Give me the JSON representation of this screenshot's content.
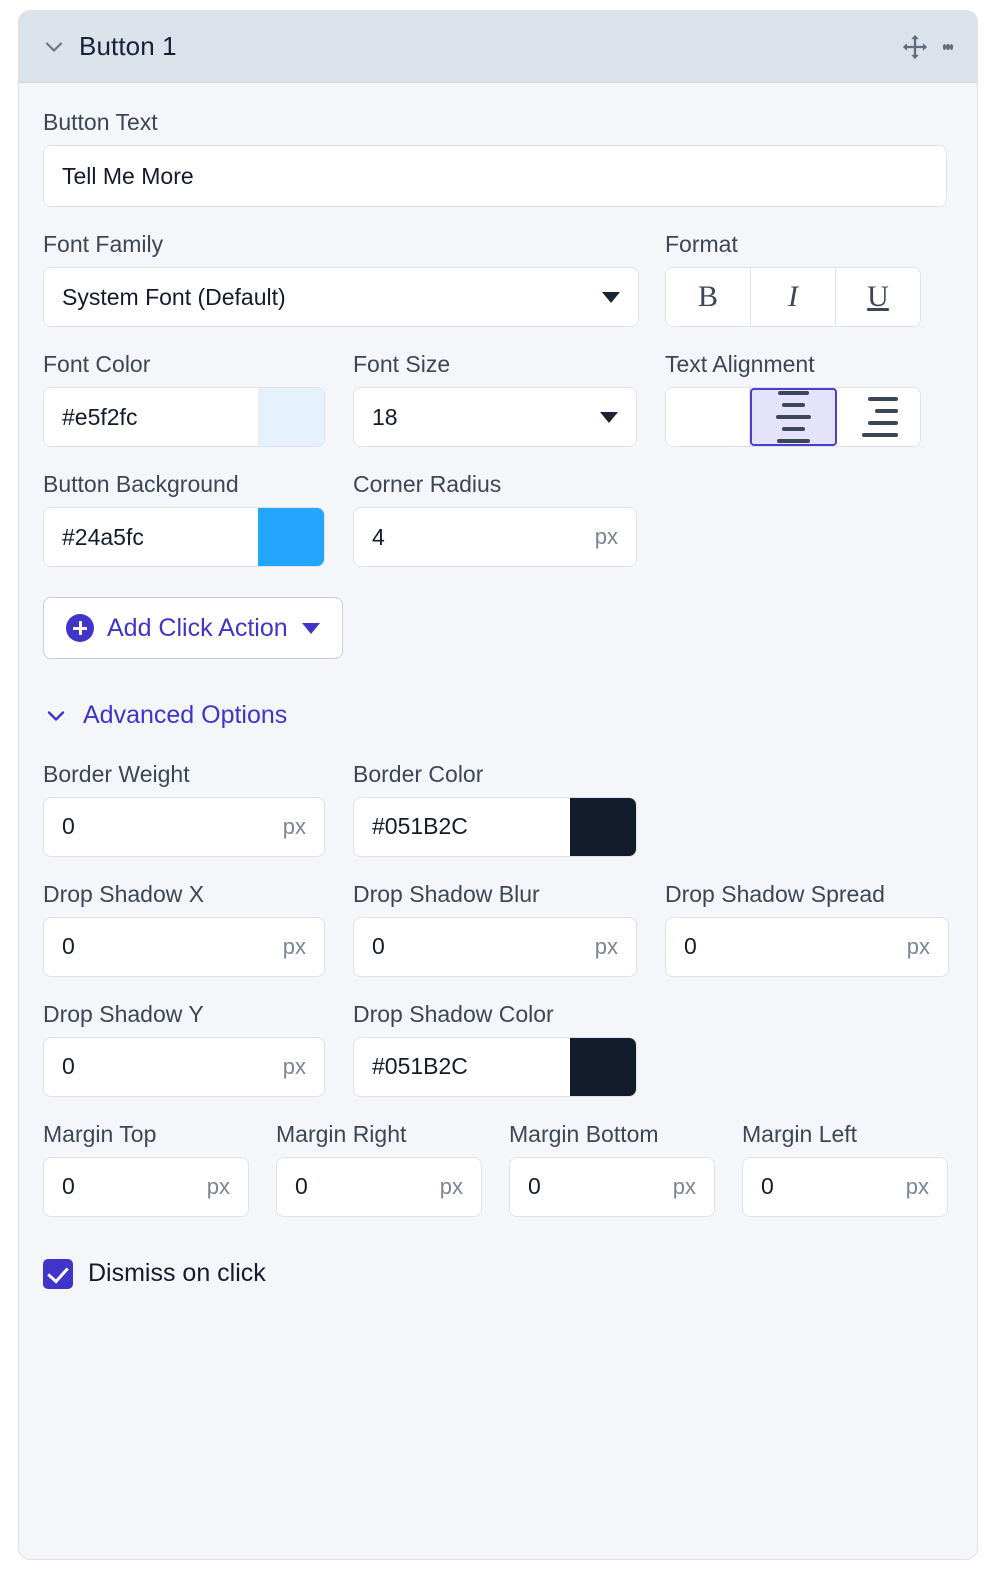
{
  "panel": {
    "header": {
      "title": "Button 1",
      "collapse_icon": "chevron-down-icon",
      "move_icon": "move-cross-arrows-icon",
      "menu_icon": "kebab-menu-icon"
    },
    "button_text": {
      "label": "Button Text",
      "value": "Tell Me More"
    },
    "font_family": {
      "label": "Font Family",
      "value": "System Font (Default)"
    },
    "format": {
      "label": "Format",
      "buttons": [
        {
          "name": "bold",
          "glyph": "B",
          "active": false
        },
        {
          "name": "italic",
          "glyph": "I",
          "active": false
        },
        {
          "name": "underline",
          "glyph": "U",
          "active": false
        }
      ]
    },
    "font_color": {
      "label": "Font Color",
      "value": "#e5f2fc",
      "swatch": "#e5f2fc"
    },
    "font_size": {
      "label": "Font Size",
      "value": "18"
    },
    "text_alignment": {
      "label": "Text Alignment",
      "options": [
        {
          "name": "align-left",
          "selected": false
        },
        {
          "name": "align-center",
          "selected": true
        },
        {
          "name": "align-right",
          "selected": false
        }
      ]
    },
    "button_background": {
      "label": "Button Background",
      "value": "#24a5fc",
      "swatch": "#24a5fc"
    },
    "corner_radius": {
      "label": "Corner Radius",
      "value": "4",
      "unit": "px"
    },
    "add_click_action": {
      "label": "Add Click Action"
    },
    "advanced_options": {
      "label": "Advanced Options"
    },
    "border_weight": {
      "label": "Border Weight",
      "value": "0",
      "unit": "px"
    },
    "border_color": {
      "label": "Border Color",
      "value": "#051B2C",
      "swatch": "#121c2c"
    },
    "drop_shadow_x": {
      "label": "Drop Shadow X",
      "value": "0",
      "unit": "px"
    },
    "drop_shadow_blur": {
      "label": "Drop Shadow Blur",
      "value": "0",
      "unit": "px"
    },
    "drop_shadow_spread": {
      "label": "Drop Shadow Spread",
      "value": "0",
      "unit": "px"
    },
    "drop_shadow_y": {
      "label": "Drop Shadow Y",
      "value": "0",
      "unit": "px"
    },
    "drop_shadow_color": {
      "label": "Drop Shadow Color",
      "value": "#051B2C",
      "swatch": "#121c2c"
    },
    "margin_top": {
      "label": "Margin Top",
      "value": "0",
      "unit": "px"
    },
    "margin_right": {
      "label": "Margin Right",
      "value": "0",
      "unit": "px"
    },
    "margin_bottom": {
      "label": "Margin Bottom",
      "value": "0",
      "unit": "px"
    },
    "margin_left": {
      "label": "Margin Left",
      "value": "0",
      "unit": "px"
    },
    "dismiss_on_click": {
      "label": "Dismiss on click",
      "checked": true
    }
  },
  "colors": {
    "accent_purple": "#4035c8",
    "header_bg": "#dce2e9",
    "panel_bg": "#f4f6f9",
    "selected_seg_bg": "#e5e3fa",
    "selected_seg_border": "#4b3fce"
  }
}
